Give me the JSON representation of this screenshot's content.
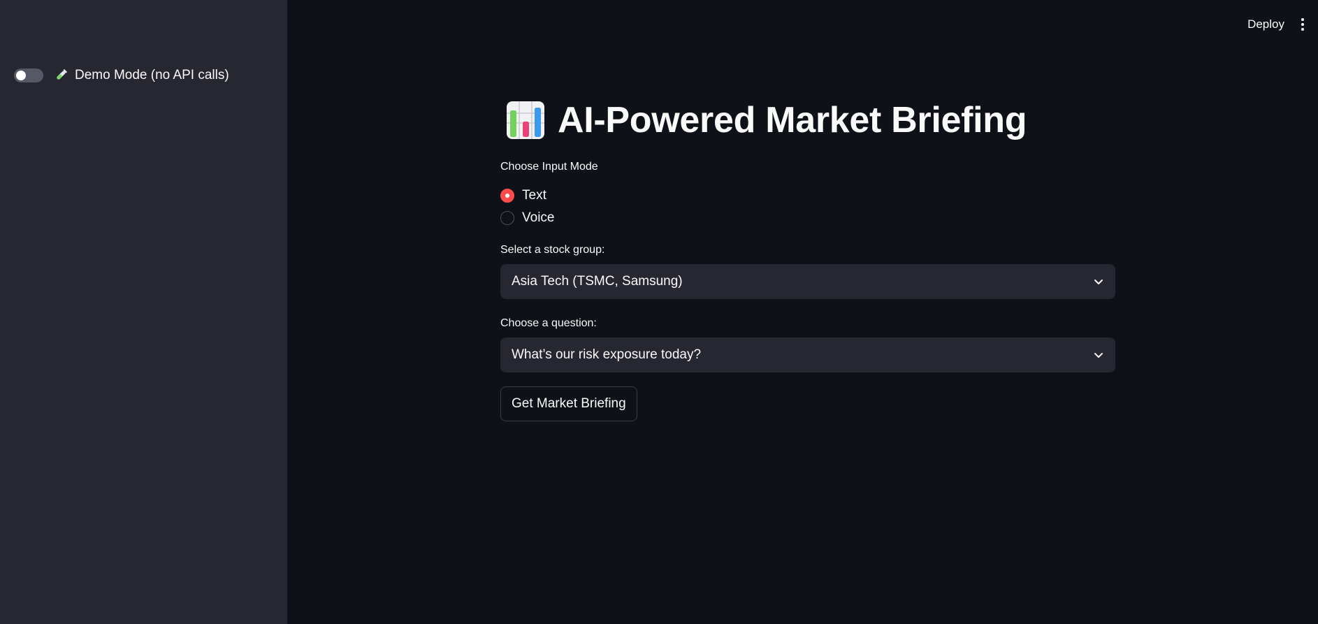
{
  "sidebar": {
    "demo_toggle": {
      "label": "Demo Mode (no API calls)",
      "enabled": false,
      "icon": "test-tube-icon"
    }
  },
  "header": {
    "deploy_label": "Deploy",
    "menu_icon": "kebab-menu-icon"
  },
  "main": {
    "title": "AI-Powered Market Briefing",
    "title_icon": "bar-chart-icon",
    "input_mode": {
      "label": "Choose Input Mode",
      "options": [
        "Text",
        "Voice"
      ],
      "selected": "Text"
    },
    "stock_group": {
      "label": "Select a stock group:",
      "value": "Asia Tech (TSMC, Samsung)"
    },
    "question": {
      "label": "Choose a question:",
      "value": "What’s our risk exposure today?"
    },
    "submit_label": "Get Market Briefing"
  },
  "colors": {
    "background": "#0e1117",
    "sidebar": "#262730",
    "accent": "#ff4b4b",
    "text": "#fafafa"
  }
}
